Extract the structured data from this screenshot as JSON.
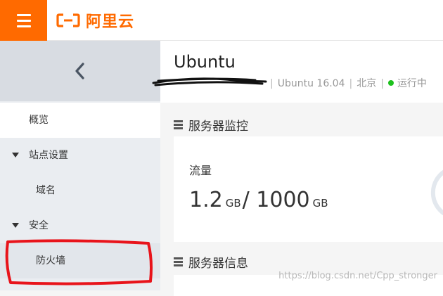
{
  "brand": {
    "name": "阿里云",
    "color": "#ff6a00"
  },
  "sidebar": {
    "back_icon": "chevron-left-icon",
    "items": [
      {
        "label": "概览",
        "type": "item"
      },
      {
        "label": "站点设置",
        "type": "group",
        "expanded": true
      },
      {
        "label": "域名",
        "type": "sub"
      },
      {
        "label": "安全",
        "type": "group",
        "expanded": true
      },
      {
        "label": "防火墙",
        "type": "sub"
      }
    ]
  },
  "instance": {
    "name": "Ubuntu",
    "os": "Ubuntu 16.04",
    "region": "北京",
    "status": "运行中",
    "status_color": "#1dc11d"
  },
  "monitor": {
    "section_title": "服务器监控",
    "traffic_label": "流量",
    "traffic_used": "1.2",
    "traffic_used_unit": "GB",
    "traffic_total": "1000",
    "traffic_total_unit": "GB"
  },
  "info": {
    "section_title": "服务器信息"
  },
  "watermark": "https://blog.csdn.net/Cpp_stronger"
}
